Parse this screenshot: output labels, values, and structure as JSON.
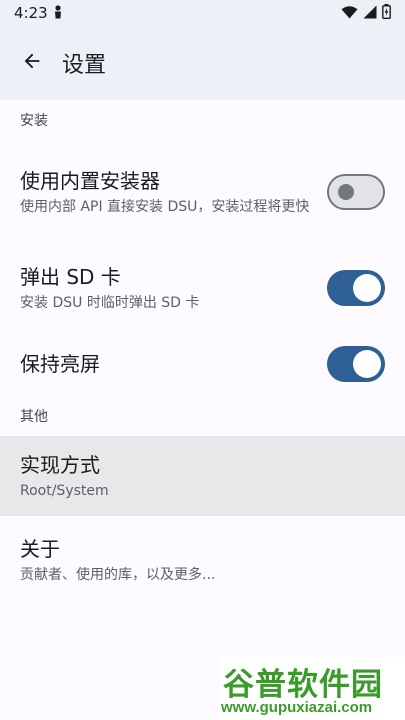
{
  "status_bar": {
    "time": "4:23"
  },
  "app_bar": {
    "title": "设置"
  },
  "sections": {
    "install": {
      "header": "安装",
      "use_builtin_installer": {
        "title": "使用内置安装器",
        "summary": "使用内部 API 直接安装 DSU，安装过程将更快",
        "enabled": false
      },
      "eject_sd": {
        "title": "弹出 SD 卡",
        "summary": "安装 DSU 时临时弹出 SD 卡",
        "enabled": true
      },
      "keep_screen_on": {
        "title": "保持亮屏",
        "enabled": true
      }
    },
    "other": {
      "header": "其他",
      "implementation": {
        "title": "实现方式",
        "summary": "Root/System"
      },
      "about": {
        "title": "关于",
        "summary": "贡献者、使用的库，以及更多..."
      }
    }
  },
  "watermark": {
    "title": "谷普软件园",
    "url": "www.gupuxiazai.com"
  },
  "colors": {
    "accent": "#2e5f96",
    "app_bar_bg": "#eef0f8",
    "watermark_green": "#3a9b2a"
  }
}
